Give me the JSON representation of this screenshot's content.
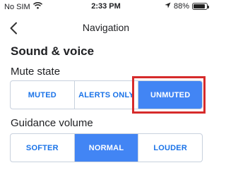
{
  "status_bar": {
    "carrier": "No SIM",
    "time": "2:33 PM",
    "battery_percent_text": "88%",
    "battery_level": 0.88
  },
  "header": {
    "title": "Navigation"
  },
  "section": {
    "title": "Sound & voice"
  },
  "mute_state": {
    "label": "Mute state",
    "options": [
      "MUTED",
      "ALERTS ONLY",
      "UNMUTED"
    ],
    "selected": "UNMUTED"
  },
  "guidance_volume": {
    "label": "Guidance volume",
    "options": [
      "SOFTER",
      "NORMAL",
      "LOUDER"
    ],
    "selected": "NORMAL"
  },
  "colors": {
    "accent": "#4285f4",
    "accent_text": "#1a73e8",
    "highlight": "#d62b2b"
  }
}
